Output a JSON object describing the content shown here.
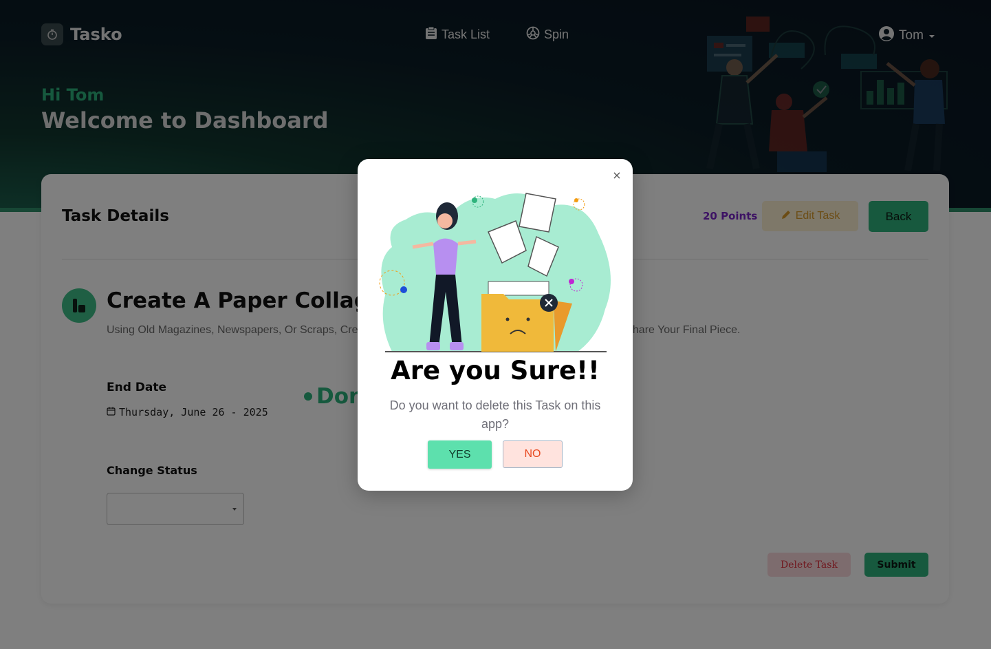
{
  "header": {
    "app_name": "Tasko",
    "nav": [
      {
        "label": "Task List",
        "icon": "clipboard-icon"
      },
      {
        "label": "Spin",
        "icon": "wheel-icon"
      }
    ],
    "user": {
      "name": "Tom"
    },
    "greeting": "Hi Tom",
    "welcome": "Welcome to Dashboard"
  },
  "card": {
    "title": "Task Details",
    "points": "20 Points",
    "edit_label": "Edit Task",
    "back_label": "Back",
    "task": {
      "name": "Create A Paper Collage",
      "description": "Using Old Magazines, Newspapers, Or Scraps, Create A Collage Of Anything You Like. Snap A Photo And Share Your Final Piece.",
      "end_date_label": "End Date",
      "end_date": "Thursday, June 26 - 2025",
      "status": "Done"
    },
    "change_status_label": "Change Status",
    "select_value": "",
    "delete_label": "Delete Task",
    "submit_label": "Submit"
  },
  "modal": {
    "close": "×",
    "title": "Are you Sure!!",
    "message": "Do you want to delete this Task on this app?",
    "yes": "YES",
    "no": "NO"
  },
  "colors": {
    "accent": "#2fb37c",
    "points": "#7b27c9",
    "danger": "#e0323f",
    "yes_bg": "#5de0ad",
    "no_bg": "#ffe3de"
  }
}
